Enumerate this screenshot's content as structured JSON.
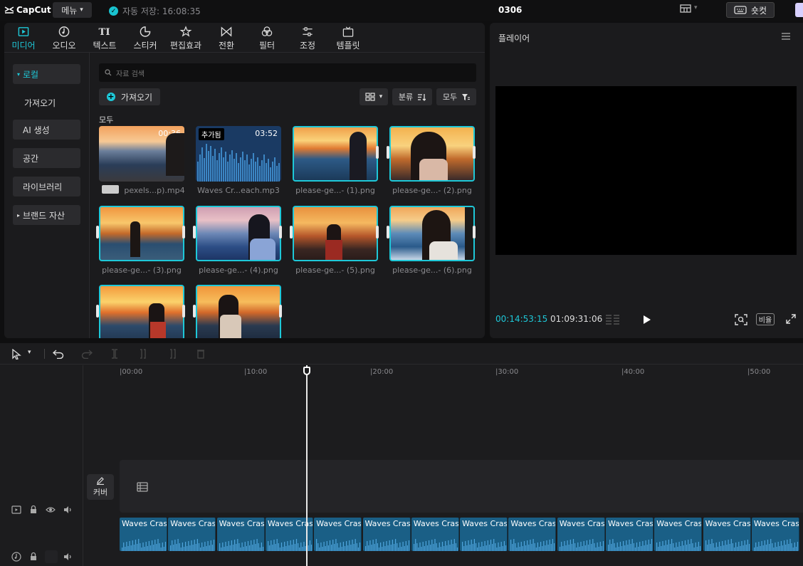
{
  "topbar": {
    "logo": "CapCut",
    "menu_label": "메뉴",
    "autosave": "자동 저장: 16:08:35",
    "project_title": "0306",
    "shortcut_label": "숏컷"
  },
  "media_tabs": [
    {
      "label": "미디어",
      "icon": "media-icon"
    },
    {
      "label": "오디오",
      "icon": "audio-icon"
    },
    {
      "label": "텍스트",
      "icon": "text-icon"
    },
    {
      "label": "스티커",
      "icon": "sticker-icon"
    },
    {
      "label": "편집효과",
      "icon": "effects-icon"
    },
    {
      "label": "전환",
      "icon": "transition-icon"
    },
    {
      "label": "필터",
      "icon": "filter-icon"
    },
    {
      "label": "조정",
      "icon": "adjust-icon"
    },
    {
      "label": "템플릿",
      "icon": "template-icon"
    }
  ],
  "sidebar": {
    "items": [
      "로컬",
      "가져오기",
      "AI 생성",
      "공간",
      "라이브러리",
      "브랜드 자산"
    ]
  },
  "media": {
    "search_placeholder": "자료 검색",
    "import_label": "가져오기",
    "sort_label": "분류",
    "filter_label": "모두",
    "section_label": "모두",
    "items": [
      {
        "name": "pexels...p).mp4",
        "duration": "00:36",
        "badge": ""
      },
      {
        "name": "Waves Cr...each.mp3",
        "duration": "03:52",
        "badge": "추가됨"
      },
      {
        "name": "please-ge...- (1).png",
        "duration": "",
        "badge": ""
      },
      {
        "name": "please-ge...- (2).png",
        "duration": "",
        "badge": ""
      },
      {
        "name": "please-ge...- (3).png",
        "duration": "",
        "badge": ""
      },
      {
        "name": "please-ge...- (4).png",
        "duration": "",
        "badge": ""
      },
      {
        "name": "please-ge...- (5).png",
        "duration": "",
        "badge": ""
      },
      {
        "name": "please-ge...- (6).png",
        "duration": "",
        "badge": ""
      },
      {
        "name": "",
        "duration": "",
        "badge": ""
      },
      {
        "name": "",
        "duration": "",
        "badge": ""
      }
    ]
  },
  "player": {
    "title": "플레이어",
    "current_time": "00:14:53:15",
    "total_time": "01:09:31:06",
    "ratio_label": "비율"
  },
  "timeline": {
    "ruler": [
      "|00:00",
      "|10:00",
      "|20:00",
      "|30:00",
      "|40:00",
      "|50:00"
    ],
    "cover_label": "커버",
    "audio_clip_label": "Waves Crash"
  },
  "colors": {
    "accent": "#1ec8d8",
    "audio_clip": "#1a5f86",
    "panel": "#1b1b1d"
  }
}
